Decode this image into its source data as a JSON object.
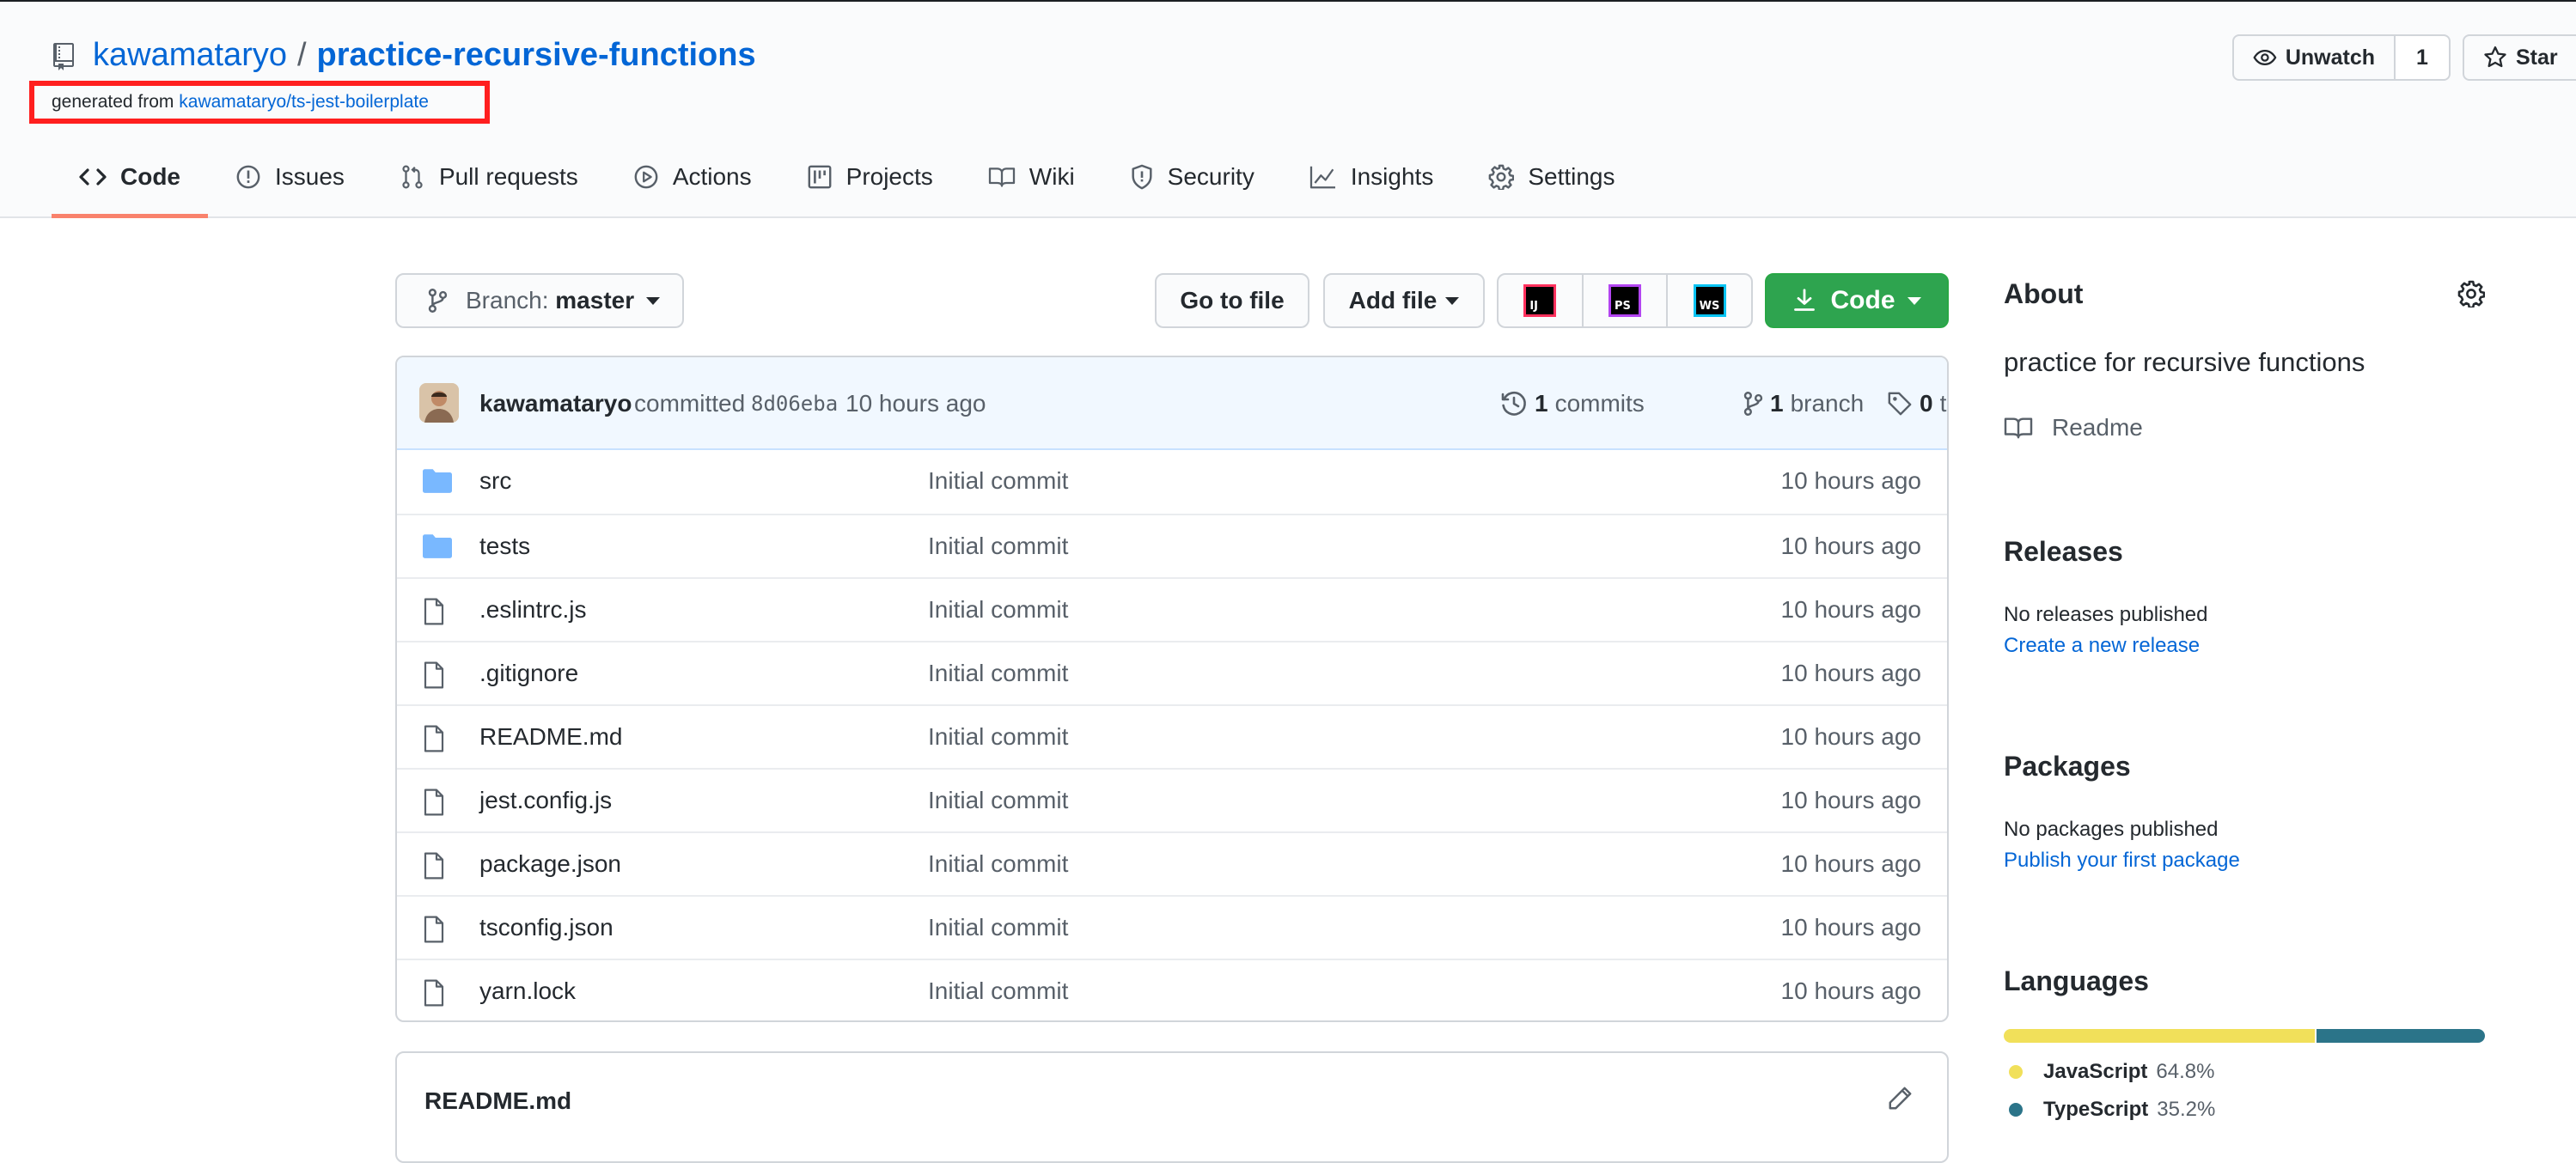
{
  "repo": {
    "owner": "kawamataryo",
    "separator": "/",
    "name": "practice-recursive-functions",
    "generated_prefix": "generated from",
    "generated_link": "kawamataryo/ts-jest-boilerplate"
  },
  "header_actions": {
    "unwatch_label": "Unwatch",
    "unwatch_count": "1",
    "star_label": "Star"
  },
  "tabs": [
    {
      "label": "Code",
      "icon": "code-icon"
    },
    {
      "label": "Issues",
      "icon": "issue-icon"
    },
    {
      "label": "Pull requests",
      "icon": "pull-request-icon"
    },
    {
      "label": "Actions",
      "icon": "play-icon"
    },
    {
      "label": "Projects",
      "icon": "project-icon"
    },
    {
      "label": "Wiki",
      "icon": "book-icon"
    },
    {
      "label": "Security",
      "icon": "shield-icon"
    },
    {
      "label": "Insights",
      "icon": "graph-icon"
    },
    {
      "label": "Settings",
      "icon": "gear-icon"
    }
  ],
  "toolbar": {
    "branch_prefix": "Branch:",
    "branch_name": "master",
    "go_to_file": "Go to file",
    "add_file": "Add file",
    "code": "Code",
    "ides": [
      "IJ",
      "PS",
      "WS"
    ]
  },
  "commit": {
    "author": "kawamataryo",
    "action": "committed",
    "sha": "8d06eba",
    "time": "10 hours ago",
    "commits_count": "1",
    "commits_label": "commits",
    "branch_count": "1",
    "branch_label": "branch",
    "tags_count": "0",
    "tags_label": "tags"
  },
  "files": [
    {
      "name": "src",
      "type": "dir",
      "message": "Initial commit",
      "time": "10 hours ago"
    },
    {
      "name": "tests",
      "type": "dir",
      "message": "Initial commit",
      "time": "10 hours ago"
    },
    {
      "name": ".eslintrc.js",
      "type": "file",
      "message": "Initial commit",
      "time": "10 hours ago"
    },
    {
      "name": ".gitignore",
      "type": "file",
      "message": "Initial commit",
      "time": "10 hours ago"
    },
    {
      "name": "README.md",
      "type": "file",
      "message": "Initial commit",
      "time": "10 hours ago"
    },
    {
      "name": "jest.config.js",
      "type": "file",
      "message": "Initial commit",
      "time": "10 hours ago"
    },
    {
      "name": "package.json",
      "type": "file",
      "message": "Initial commit",
      "time": "10 hours ago"
    },
    {
      "name": "tsconfig.json",
      "type": "file",
      "message": "Initial commit",
      "time": "10 hours ago"
    },
    {
      "name": "yarn.lock",
      "type": "file",
      "message": "Initial commit",
      "time": "10 hours ago"
    }
  ],
  "readme": {
    "title": "README.md"
  },
  "sidebar": {
    "about_title": "About",
    "description": "practice for recursive functions",
    "readme_label": "Readme",
    "releases_title": "Releases",
    "releases_none": "No releases published",
    "releases_link": "Create a new release",
    "packages_title": "Packages",
    "packages_none": "No packages published",
    "packages_link": "Publish your first package",
    "languages_title": "Languages",
    "languages": [
      {
        "name": "JavaScript",
        "percent": "64.8%",
        "value": 64.8,
        "color": "#f1e05a"
      },
      {
        "name": "TypeScript",
        "percent": "35.2%",
        "value": 35.2,
        "color": "#2b7489"
      }
    ]
  },
  "colors": {
    "link": "#0366d6",
    "accent_tab": "#f9826c",
    "code_button": "#2ea44f",
    "highlight_box": "#ff1f1f",
    "folder": "#79b8ff"
  }
}
